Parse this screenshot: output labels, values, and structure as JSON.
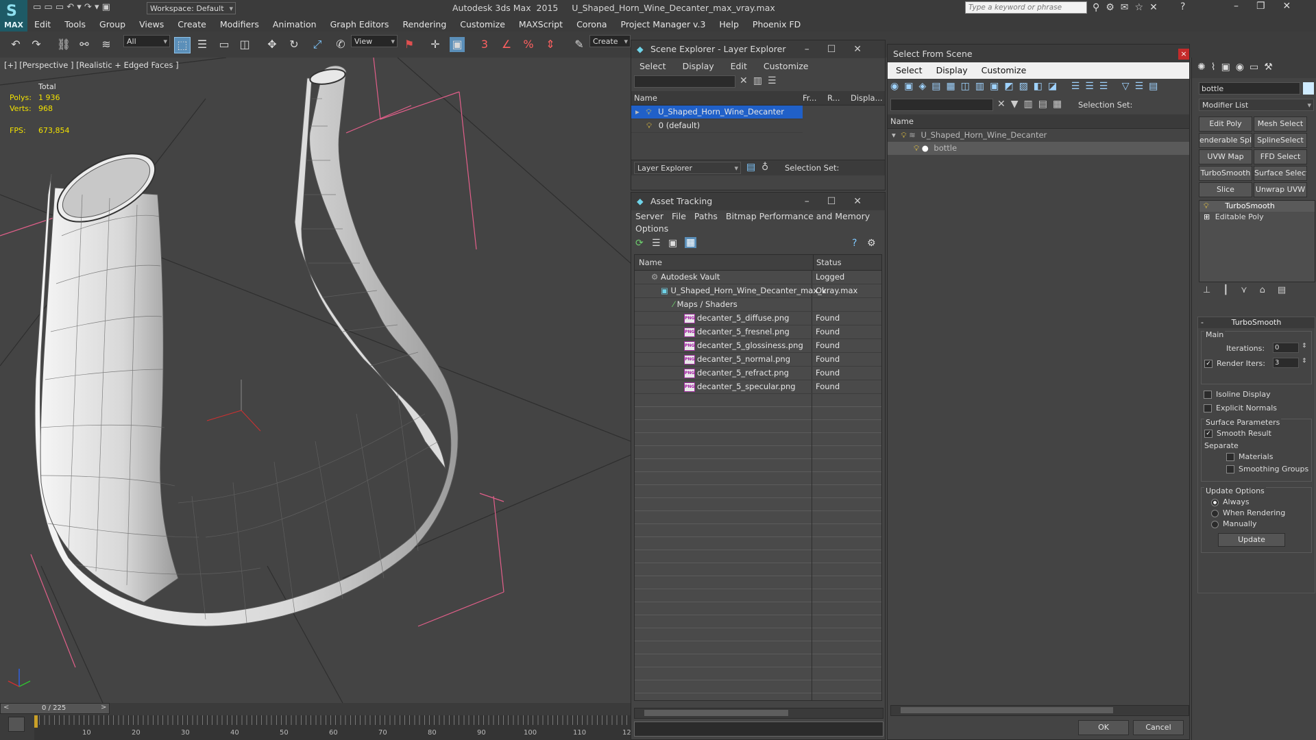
{
  "app": {
    "title": "Autodesk 3ds Max  2015     U_Shaped_Horn_Wine_Decanter_max_vray.max",
    "workspace": "Workspace: Default",
    "search_placeholder": "Type a keyword or phrase",
    "logo": "MAX"
  },
  "menu": [
    "Edit",
    "Tools",
    "Group",
    "Views",
    "Create",
    "Modifiers",
    "Animation",
    "Graph Editors",
    "Rendering",
    "Customize",
    "MAXScript",
    "Corona",
    "Project Manager v.3",
    "Help",
    "Phoenix FD"
  ],
  "toolbar": {
    "filter": "All",
    "refcoord": "View",
    "selection_set": "Create Selecti"
  },
  "viewport": {
    "label": "[+] [Perspective ] [Realistic + Edged Faces ]",
    "stats_header": "Total",
    "polys_label": "Polys:",
    "polys": "1 936",
    "verts_label": "Verts:",
    "verts": "968",
    "fps_label": "FPS:",
    "fps": "673,854"
  },
  "timeline": {
    "frame": "0 / 225",
    "ticks": [
      "0",
      "10",
      "20",
      "30",
      "40",
      "50",
      "60",
      "70",
      "80",
      "90",
      "100",
      "110",
      "12"
    ]
  },
  "scene_explorer": {
    "title": "Scene Explorer - Layer Explorer",
    "menu": [
      "Select",
      "Display",
      "Edit",
      "Customize"
    ],
    "cols": [
      "Name",
      "Fr...",
      "R...",
      "Displa..."
    ],
    "rows": [
      "U_Shaped_Horn_Wine_Decanter",
      "0 (default)"
    ],
    "footer_combo": "Layer Explorer",
    "footer_label": "Selection Set:"
  },
  "asset_tracking": {
    "title": "Asset Tracking",
    "menu": [
      "Server",
      "File",
      "Paths",
      "Bitmap Performance and Memory",
      "Options"
    ],
    "cols": [
      "Name",
      "Status"
    ],
    "rows": [
      {
        "name": "Autodesk Vault",
        "status": "Logged"
      },
      {
        "name": "U_Shaped_Horn_Wine_Decanter_max_vray.max",
        "status": "Ok"
      },
      {
        "name": "Maps / Shaders",
        "status": ""
      },
      {
        "name": "decanter_5_diffuse.png",
        "status": "Found"
      },
      {
        "name": "decanter_5_fresnel.png",
        "status": "Found"
      },
      {
        "name": "decanter_5_glossiness.png",
        "status": "Found"
      },
      {
        "name": "decanter_5_normal.png",
        "status": "Found"
      },
      {
        "name": "decanter_5_refract.png",
        "status": "Found"
      },
      {
        "name": "decanter_5_specular.png",
        "status": "Found"
      }
    ]
  },
  "select_from_scene": {
    "title": "Select From Scene",
    "menu": [
      "Select",
      "Display",
      "Customize"
    ],
    "selection_set": "Selection Set:",
    "col_name": "Name",
    "tree": [
      "U_Shaped_Horn_Wine_Decanter",
      "bottle"
    ],
    "ok": "OK",
    "cancel": "Cancel"
  },
  "command_panel": {
    "object_name": "bottle",
    "modifier_list": "Modifier List",
    "buttons": [
      "Edit Poly",
      "Mesh Select",
      "enderable Spli",
      "SplineSelect",
      "UVW Map",
      "FFD Select",
      "TurboSmooth",
      "Surface Select",
      "Slice",
      "Unwrap UVW"
    ],
    "stack": [
      "TurboSmooth",
      "Editable Poly"
    ],
    "rollout_title": "TurboSmooth",
    "main": "Main",
    "iterations_label": "Iterations:",
    "iterations": "0",
    "render_iters_label": "Render Iters:",
    "render_iters": "3",
    "isoline": "Isoline Display",
    "explicit_normals": "Explicit Normals",
    "surface_params": "Surface Parameters",
    "smooth_result": "Smooth Result",
    "separate": "Separate",
    "materials": "Materials",
    "smoothing_groups": "Smoothing Groups",
    "update_options": "Update Options",
    "always": "Always",
    "when_rendering": "When Rendering",
    "manually": "Manually",
    "update": "Update"
  }
}
